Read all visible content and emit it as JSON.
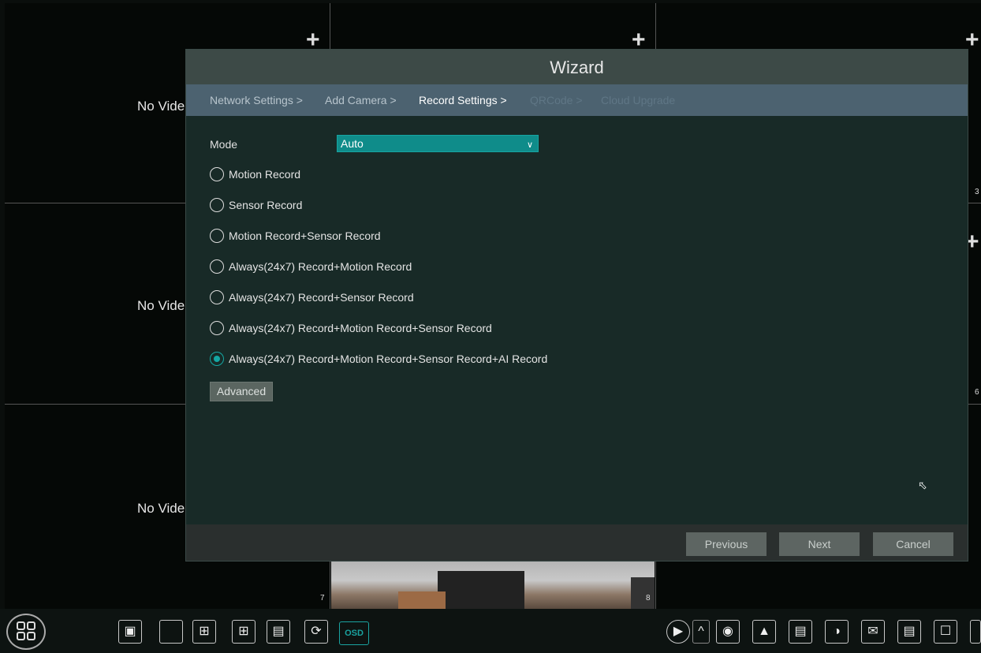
{
  "grid": {
    "no_video": [
      "No Vide",
      "No Vide",
      "No Vide"
    ],
    "cell_numbers": [
      "3",
      "6",
      "7",
      "8"
    ],
    "plus_glyph": "+"
  },
  "wizard": {
    "title": "Wizard",
    "steps": [
      {
        "label": "Network Settings >",
        "state": "done"
      },
      {
        "label": "Add Camera >",
        "state": "done"
      },
      {
        "label": "Record Settings >",
        "state": "active"
      },
      {
        "label": "QRCode >",
        "state": "future"
      },
      {
        "label": "Cloud Upgrade",
        "state": "future"
      }
    ],
    "mode_label": "Mode",
    "mode_value": "Auto",
    "options": [
      {
        "label": "Motion Record",
        "selected": false
      },
      {
        "label": "Sensor Record",
        "selected": false
      },
      {
        "label": "Motion Record+Sensor Record",
        "selected": false
      },
      {
        "label": "Always(24x7) Record+Motion Record",
        "selected": false
      },
      {
        "label": "Always(24x7) Record+Sensor Record",
        "selected": false
      },
      {
        "label": "Always(24x7) Record+Motion Record+Sensor Record",
        "selected": false
      },
      {
        "label": "Always(24x7) Record+Motion Record+Sensor Record+AI Record",
        "selected": true
      }
    ],
    "advanced_label": "Advanced",
    "previous_label": "Previous",
    "next_label": "Next",
    "cancel_label": "Cancel",
    "accent_color": "#14a6a3"
  },
  "toolbar": {
    "osd_label": "OSD"
  }
}
